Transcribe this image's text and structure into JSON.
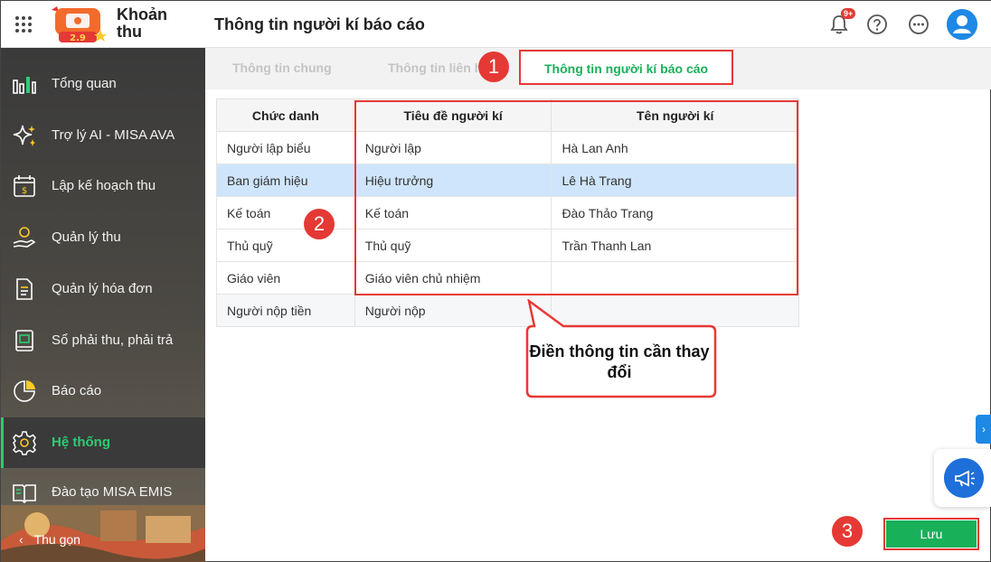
{
  "header": {
    "app_name": "Khoản thu",
    "page_title": "Thông tin người kí báo cáo",
    "notification_badge": "9+"
  },
  "sidebar": {
    "items": [
      {
        "label": "Tổng quan",
        "icon": "bar-chart-icon"
      },
      {
        "label": "Trợ lý AI - MISA AVA",
        "icon": "sparkle-icon"
      },
      {
        "label": "Lập kế hoạch thu",
        "icon": "calendar-dollar-icon"
      },
      {
        "label": "Quản lý thu",
        "icon": "hand-coin-icon"
      },
      {
        "label": "Quản lý hóa đơn",
        "icon": "document-icon"
      },
      {
        "label": "Sổ phải thu, phải trả",
        "icon": "ledger-icon"
      },
      {
        "label": "Báo cáo",
        "icon": "pie-chart-icon"
      },
      {
        "label": "Hệ thống",
        "icon": "gear-icon",
        "active": true
      },
      {
        "label": "Đào tạo MISA EMIS",
        "icon": "book-icon"
      }
    ],
    "collapse_label": "Thu gọn"
  },
  "tabs": [
    {
      "label": "Thông tin chung"
    },
    {
      "label": "Thông tin liên h"
    },
    {
      "label": "Thông tin người kí báo cáo",
      "active": true
    }
  ],
  "table": {
    "headers": [
      "Chức danh",
      "Tiêu đề người kí",
      "Tên người kí"
    ],
    "rows": [
      [
        "Người lập biểu",
        "Người lập",
        "Hà Lan Anh"
      ],
      [
        "Ban giám hiệu",
        "Hiệu trưởng",
        "Lê Hà Trang"
      ],
      [
        "Kế toán",
        "Kế toán",
        "Đào Thảo Trang"
      ],
      [
        "Thủ quỹ",
        "Thủ quỹ",
        "Trần Thanh Lan"
      ],
      [
        "Giáo viên",
        "Giáo viên chủ nhiệm",
        ""
      ],
      [
        "Người nộp tiền",
        "Người nộp",
        ""
      ]
    ],
    "selected_row": 1
  },
  "annotations": {
    "markers": [
      "1",
      "2",
      "3"
    ],
    "callout_text": "Điền thông tin cần thay đổi"
  },
  "save_label": "Lưu",
  "colors": {
    "accent_green": "#19b05a",
    "highlight_red": "#e53935",
    "selected_row": "#cfe5fb",
    "sidebar_dark": "#3a3a3a"
  }
}
